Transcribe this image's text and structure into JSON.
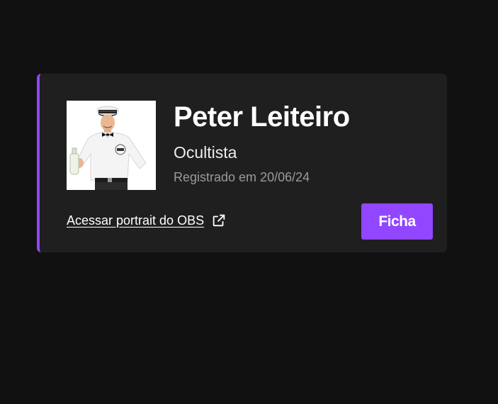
{
  "card": {
    "accent_color": "#9146ff",
    "avatar_alt": "avatar",
    "name": "Peter Leiteiro",
    "role": "Ocultista",
    "registered": "Registrado em 20/06/24",
    "obs_link_label": "Acessar portrait do OBS",
    "obs_link_icon": "external-link-icon",
    "ficha_button_label": "Ficha"
  }
}
